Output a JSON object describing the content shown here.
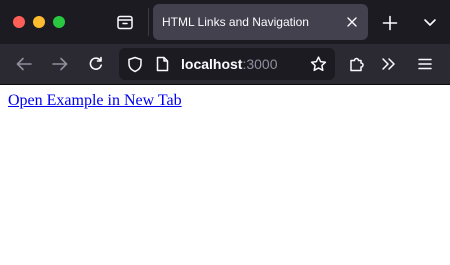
{
  "window": {
    "traffic_lights": {
      "close_color": "#ff5f57",
      "minimize_color": "#febc2e",
      "maximize_color": "#28c840"
    }
  },
  "tabstrip": {
    "tab_overview_icon": "tab-overview-icon",
    "active_tab": {
      "title": "HTML Links and Navigation",
      "close_icon": "close-icon"
    },
    "new_tab_icon": "plus-icon",
    "list_all_tabs_icon": "chevron-down-icon"
  },
  "toolbar": {
    "back_icon": "arrow-left-icon",
    "forward_icon": "arrow-right-icon",
    "reload_icon": "reload-icon",
    "urlbar": {
      "shield_icon": "shield-icon",
      "page_icon": "page-icon",
      "host": "localhost",
      "port": ":3000",
      "bookmark_icon": "star-icon"
    },
    "extensions_icon": "puzzle-icon",
    "overflow_icon": "double-chevron-icon",
    "menu_icon": "hamburger-icon"
  },
  "page": {
    "link_text": "Open Example in New Tab",
    "link_color": "#0000ee"
  }
}
